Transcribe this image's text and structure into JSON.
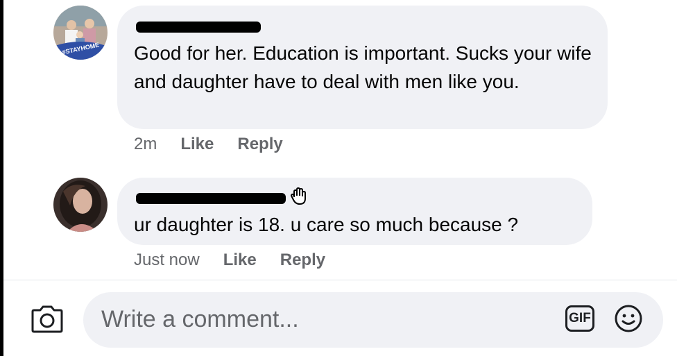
{
  "comments": [
    {
      "author": "[redacted]",
      "avatar_badge": "#STAYHOME",
      "text": "Good for her. Education is important. Sucks your wife and daughter have to deal with men like you.",
      "time": "2m",
      "like_label": "Like",
      "reply_label": "Reply"
    },
    {
      "author": "[redacted]",
      "author_emoji": "waving-hand",
      "text": "ur daughter is 18. u care so much because ?",
      "time": "Just now",
      "like_label": "Like",
      "reply_label": "Reply"
    }
  ],
  "composer": {
    "placeholder": "Write a comment...",
    "gif_label": "GIF"
  },
  "icons": {
    "camera": "camera-icon",
    "gif": "gif-icon",
    "emoji": "emoji-icon"
  },
  "colors": {
    "bubble": "#f0f1f5",
    "meta_text": "#65676b",
    "body_text": "#050505",
    "badge_blue": "#2f4fa5"
  }
}
